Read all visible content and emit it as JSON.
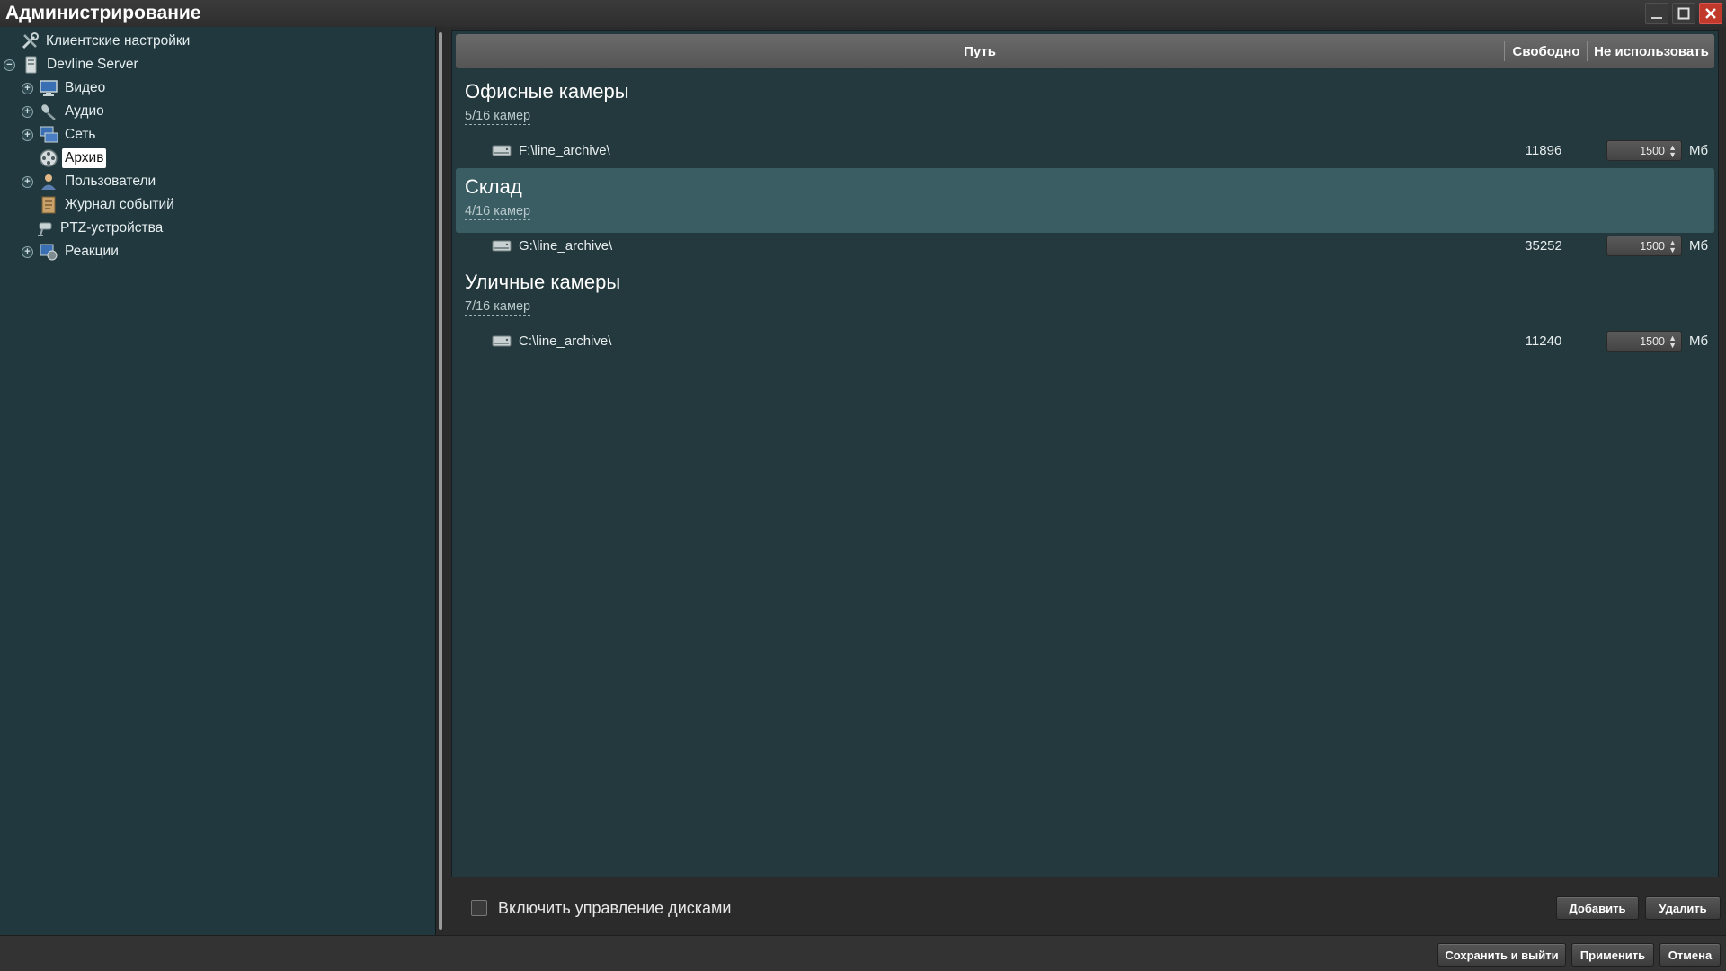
{
  "window": {
    "title": "Администрирование",
    "controls": [
      "minimize-icon",
      "maximize-icon",
      "close-icon"
    ],
    "close_color": "#c0392b"
  },
  "sidebar": {
    "items": [
      {
        "label": "Клиентские настройки",
        "icon": "tools-icon",
        "expander": "none",
        "level": 0
      },
      {
        "label": "Devline Server",
        "icon": "server-icon",
        "expander": "minus",
        "level": 0
      },
      {
        "label": "Видео",
        "icon": "monitor-icon",
        "expander": "plus",
        "level": 1
      },
      {
        "label": "Аудио",
        "icon": "microphone-icon",
        "expander": "plus",
        "level": 1
      },
      {
        "label": "Сеть",
        "icon": "network-icon",
        "expander": "plus",
        "level": 1
      },
      {
        "label": "Архив",
        "icon": "film-reel-icon",
        "expander": "none",
        "level": 1,
        "selected": true
      },
      {
        "label": "Пользователи",
        "icon": "user-icon",
        "expander": "plus",
        "level": 1
      },
      {
        "label": "Журнал событий",
        "icon": "journal-icon",
        "expander": "none",
        "level": 1
      },
      {
        "label": "PTZ-устройства",
        "icon": "ptz-camera-icon",
        "expander": "none",
        "level": 1
      },
      {
        "label": "Реакции",
        "icon": "reactions-icon",
        "expander": "plus",
        "level": 1
      }
    ]
  },
  "table": {
    "headers": {
      "path": "Путь",
      "free": "Свободно",
      "no_use": "Не использовать"
    },
    "groups": [
      {
        "name": "Офисные камеры",
        "count": "5/16 камер",
        "highlight": false,
        "disk": {
          "path": "F:\\line_archive\\",
          "free": "11896",
          "reserve": "1500",
          "unit": "Мб"
        }
      },
      {
        "name": "Склад",
        "count": "4/16 камер",
        "highlight": true,
        "disk": {
          "path": "G:\\line_archive\\",
          "free": "35252",
          "reserve": "1500",
          "unit": "Мб"
        }
      },
      {
        "name": "Уличные камеры",
        "count": "7/16 камер",
        "highlight": false,
        "disk": {
          "path": "C:\\line_archive\\",
          "free": "11240",
          "reserve": "1500",
          "unit": "Мб"
        }
      }
    ]
  },
  "disk_management": {
    "label": "Включить управление дисками",
    "checked": false
  },
  "buttons": {
    "add": "Добавить",
    "remove": "Удалить",
    "save_exit": "Сохранить и выйти",
    "apply": "Применить",
    "cancel": "Отмена"
  },
  "colors": {
    "sidebar_bg": "#21393e",
    "content_bg": "#24393d",
    "highlight_row": "#3a5d64",
    "header_bg": "#606060"
  }
}
